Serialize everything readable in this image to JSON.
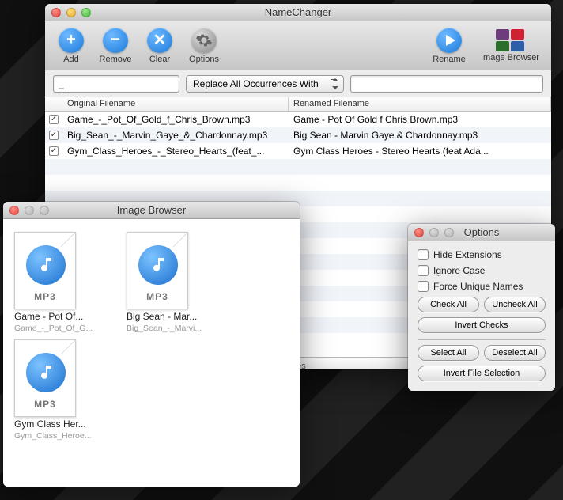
{
  "main": {
    "title": "NameChanger",
    "toolbar": {
      "add": "Add",
      "remove": "Remove",
      "clear": "Clear",
      "options": "Options",
      "rename": "Rename",
      "imageBrowser": "Image Browser"
    },
    "controls": {
      "findValue": "_",
      "modeLabel": "Replace All Occurrences With",
      "replaceValue": ""
    },
    "columns": {
      "original": "Original Filename",
      "renamed": "Renamed Filename"
    },
    "rows": [
      {
        "checked": true,
        "original": "Game_-_Pot_Of_Gold_f_Chris_Brown.mp3",
        "renamed": "Game - Pot Of Gold f Chris Brown.mp3"
      },
      {
        "checked": true,
        "original": "Big_Sean_-_Marvin_Gaye_&_Chardonnay.mp3",
        "renamed": "Big Sean - Marvin Gaye & Chardonnay.mp3"
      },
      {
        "checked": true,
        "original": "Gym_Class_Heroes_-_Stereo_Hearts_(feat_...",
        "renamed": "Gym Class Heroes - Stereo Hearts (feat Ada..."
      }
    ],
    "status": "files"
  },
  "imageBrowser": {
    "title": "Image Browser",
    "ext": "MP3",
    "items": [
      {
        "name": "Game - Pot Of...",
        "sub": "Game_-_Pot_Of_G..."
      },
      {
        "name": "Big Sean - Mar...",
        "sub": "Big_Sean_-_Marvi..."
      },
      {
        "name": "Gym Class Her...",
        "sub": "Gym_Class_Heroe..."
      }
    ]
  },
  "options": {
    "title": "Options",
    "checks": {
      "hideExt": "Hide Extensions",
      "ignoreCase": "Ignore Case",
      "forceUnique": "Force Unique Names"
    },
    "buttons": {
      "checkAll": "Check All",
      "uncheckAll": "Uncheck All",
      "invertChecks": "Invert Checks",
      "selectAll": "Select All",
      "deselectAll": "Deselect All",
      "invertFile": "Invert File Selection"
    }
  },
  "colors": {
    "accent": "#1a7bdc"
  }
}
